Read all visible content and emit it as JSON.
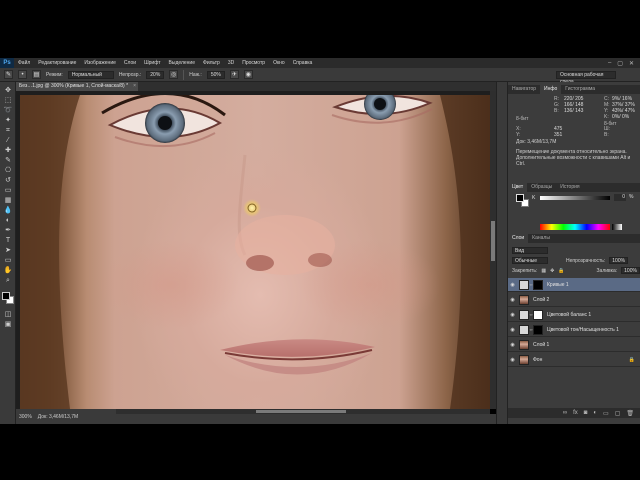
{
  "app": {
    "logo": "Ps"
  },
  "menu": [
    "Файл",
    "Редактирование",
    "Изображение",
    "Слои",
    "Шрифт",
    "Выделение",
    "Фильтр",
    "3D",
    "Просмотр",
    "Окно",
    "Справка"
  ],
  "window_controls": [
    "–",
    "▢",
    "✕"
  ],
  "options_bar": {
    "mode_label": "Режим:",
    "mode_value": "Нормальный",
    "opacity_label": "Непрозр.:",
    "opacity_value": "20%",
    "flow_label": "Наж.:",
    "flow_value": "50%",
    "workspace": "Основная рабочая среда"
  },
  "document": {
    "tab_title": "Без…1.jpg @ 300% (Кривые 1, Слой-маска/8) *",
    "tab_close": "×",
    "zoom": "300%",
    "doc_size": "Док: 3,46M/13,7M"
  },
  "info_panel": {
    "tabs": [
      "Навигатор",
      "Инфо",
      "Гистограмма"
    ],
    "active_tab": "Инфо",
    "rows": [
      {
        "label": "R:",
        "value": "220/ 205"
      },
      {
        "label": "G:",
        "value": "166/ 148"
      },
      {
        "label": "B:",
        "value": "136/ 143"
      },
      {
        "label": "C:",
        "value": "9%/ 16%"
      },
      {
        "label": "M:",
        "value": "37%/ 37%"
      },
      {
        "label": "Y:",
        "value": "43%/ 47%"
      },
      {
        "label": "K:",
        "value": "0%/ 0%"
      }
    ],
    "bit_left": "8-бит",
    "bit_right": "8-бит",
    "x_label": "X:",
    "x_value": "475",
    "y_label": "Y:",
    "y_value": "351",
    "w_label": "Ш:",
    "h_label": "В:",
    "doc_size": "Док: 3,46M/13,7M",
    "hint_line1": "Перемещение документа относительно экрана.",
    "hint_line2": "Дополнительные возможности с клавишами Alt и Ctrl."
  },
  "color_panel": {
    "tabs": [
      "Цвет",
      "Образцы",
      "История"
    ],
    "active_tab": "Цвет",
    "k_label": "K",
    "k_value": "0",
    "k_pct": "%"
  },
  "layers_panel": {
    "tabs": [
      "Слои",
      "Каналы"
    ],
    "active_tab": "Слои",
    "filter_value": "Вид",
    "blend_mode": "Обычные",
    "opacity_label": "Непрозрачность:",
    "opacity_value": "100%",
    "lock_label": "Закрепить:",
    "fill_label": "Заливка:",
    "fill_value": "100%",
    "layers": [
      {
        "name": "Кривые 1",
        "thumb": "adjust",
        "mask": "black",
        "selected": true,
        "lock": ""
      },
      {
        "name": "Слой 2",
        "thumb": "photo",
        "mask": "",
        "selected": false,
        "lock": ""
      },
      {
        "name": "Цветовой баланс 1",
        "thumb": "adjust",
        "mask": "white",
        "selected": false,
        "lock": ""
      },
      {
        "name": "Цветовой тон/Насыщенность 1",
        "thumb": "adjust",
        "mask": "black",
        "selected": false,
        "lock": ""
      },
      {
        "name": "Слой 1",
        "thumb": "photo",
        "mask": "",
        "selected": false,
        "lock": ""
      },
      {
        "name": "Фон",
        "thumb": "photo",
        "mask": "",
        "selected": false,
        "lock": "🔒"
      }
    ]
  }
}
